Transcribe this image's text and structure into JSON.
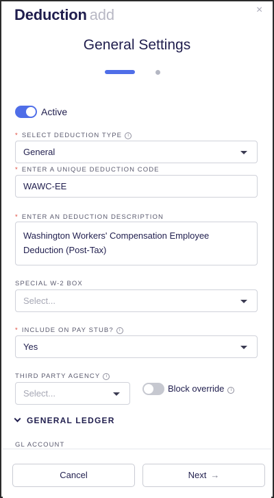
{
  "header": {
    "title": "Deduction",
    "title_suffix": "add",
    "close_icon": "close-icon"
  },
  "section": {
    "title": "General Settings",
    "steps_total": 2,
    "current_step": 1
  },
  "active_toggle": {
    "label": "Active",
    "on": true
  },
  "deduction_type": {
    "label": "SELECT DEDUCTION TYPE",
    "required": "*",
    "info": "i",
    "value": "General"
  },
  "deduction_code": {
    "label": "ENTER A UNIQUE DEDUCTION CODE",
    "required": "*",
    "value": "WAWC-EE"
  },
  "deduction_description": {
    "label": "ENTER AN DEDUCTION DESCRIPTION",
    "required": "*",
    "value": "Washington Workers' Compensation Employee Deduction (Post-Tax)"
  },
  "w2_box": {
    "label": "SPECIAL W-2 BOX",
    "placeholder": "Select..."
  },
  "pay_stub": {
    "label": "INCLUDE ON PAY STUB?",
    "required": "*",
    "info": "i",
    "value": "Yes"
  },
  "third_party": {
    "label": "THIRD PARTY AGENCY",
    "info": "i",
    "placeholder": "Select..."
  },
  "block_override": {
    "label": "Block override",
    "info": "i",
    "on": false
  },
  "general_ledger": {
    "label": "GENERAL LEDGER"
  },
  "gl_account": {
    "label": "GL ACCOUNT"
  },
  "footer": {
    "cancel_label": "Cancel",
    "next_label": "Next",
    "next_arrow": "→"
  },
  "colors": {
    "accent": "#4f6ee8",
    "text": "#1f1d4d",
    "required": "#e0483a"
  }
}
